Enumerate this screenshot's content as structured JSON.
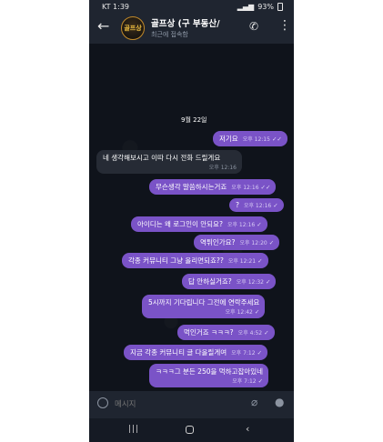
{
  "status_bar": {
    "carrier_time": "KT 1:39",
    "battery": "93%"
  },
  "header": {
    "title": "골프상 (구 부동산/",
    "subtitle": "최근에 접속함",
    "avatar_text": "골프상"
  },
  "chat": {
    "date": "9월 22일",
    "messages": [
      {
        "dir": "out",
        "text": "저기요",
        "time": "오후 12:15"
      },
      {
        "dir": "in",
        "text": "네 생각해보시고 이따 다시 전화 드릴게요",
        "time": "오후 12:16"
      },
      {
        "dir": "out",
        "text": "무슨생각 말씀하시는거죠",
        "time": "오후 12:16"
      },
      {
        "dir": "out",
        "text": "?",
        "time": "오후 12:16"
      },
      {
        "dir": "out",
        "text": "아이디는 왜 로그인이 안되요?",
        "time": "오후 12:16"
      },
      {
        "dir": "out",
        "text": "역튀인가요?",
        "time": "오후 12:20"
      },
      {
        "dir": "out",
        "text": "각종 커뮤니티 그냥 올리면되죠??",
        "time": "오후 12:21"
      },
      {
        "dir": "out",
        "text": "답 안하실거죠?",
        "time": "오후 12:32"
      },
      {
        "dir": "out",
        "text": "5시까지 기다립니다 그전에 연락주세요",
        "time": "오후 12:42"
      },
      {
        "dir": "out",
        "text": "먹인거죠 ㅋㅋㅋ?",
        "time": "오후 4:52"
      },
      {
        "dir": "out",
        "text": "지금 각종 커뮤니티 글 다올릴게여",
        "time": "오후 7:12"
      },
      {
        "dir": "out",
        "text": "ㅋㅋㅋ그 분든 250을 먹하고잡아있네",
        "time": "오후 7:12"
      }
    ]
  },
  "input": {
    "placeholder": "메시지"
  },
  "icons": {
    "back": "back-arrow-icon",
    "call": "phone-icon",
    "more": "more-vertical-icon",
    "emoji": "emoji-icon",
    "attach": "paperclip-icon",
    "mic": "microphone-icon"
  },
  "colors": {
    "outgoing_bubble": "#7a53c7",
    "incoming_bubble": "#262b35",
    "background": "#0f131b"
  }
}
